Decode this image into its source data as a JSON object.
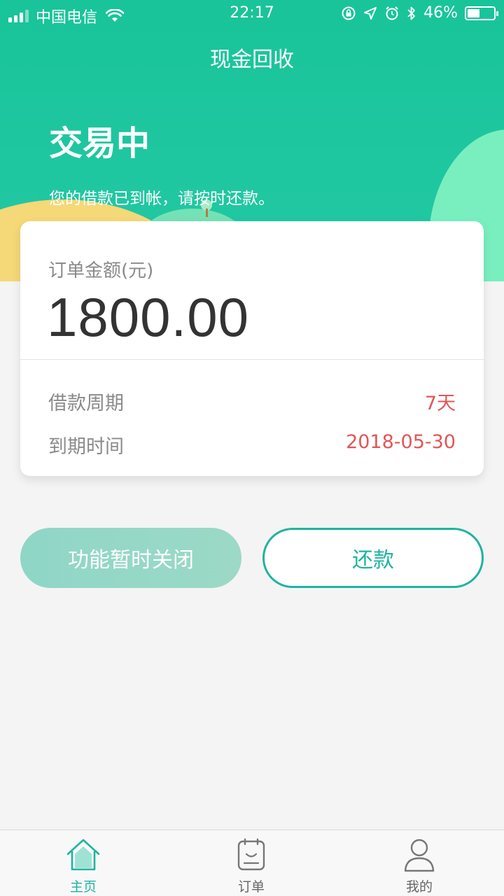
{
  "status_bar": {
    "carrier": "中国电信",
    "time": "22:17",
    "battery": "46%",
    "battery_level": 0.46
  },
  "header": {
    "title": "现金回收",
    "status_title": "交易中",
    "status_subtitle": "您的借款已到帐，请按时还款。"
  },
  "order": {
    "amount_label": "订单金额(元)",
    "amount": "1800.00",
    "period_label": "借款周期",
    "period_value": "7天",
    "due_label": "到期时间",
    "due_value": "2018-05-30"
  },
  "actions": {
    "disabled_label": "功能暂时关闭",
    "repay_label": "还款"
  },
  "tabbar": {
    "items": [
      {
        "label": "主页",
        "icon": "home-icon",
        "active": true
      },
      {
        "label": "订单",
        "icon": "order-icon",
        "active": false
      },
      {
        "label": "我的",
        "icon": "user-icon",
        "active": false
      }
    ]
  },
  "colors": {
    "brand": "#1fc7a0",
    "accent": "#1db4a0",
    "highlight": "#e25656"
  }
}
